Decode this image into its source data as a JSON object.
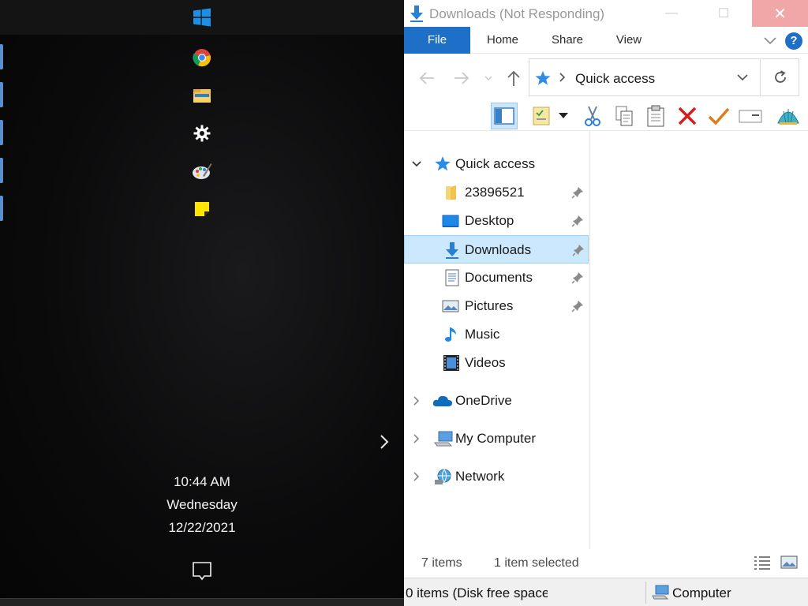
{
  "clock": {
    "time": "10:44 AM",
    "day": "Wednesday",
    "date": "12/22/2021"
  },
  "start_tiles": [
    {
      "name": "windows-logo-icon"
    },
    {
      "name": "chrome-icon"
    },
    {
      "name": "file-explorer-icon"
    },
    {
      "name": "settings-gear-icon"
    },
    {
      "name": "paint-icon"
    },
    {
      "name": "sticky-notes-icon"
    }
  ],
  "window": {
    "title": "Downloads (Not Responding)",
    "controls": {
      "minimize": "—",
      "maximize": "☐",
      "close": "✕"
    }
  },
  "ribbon": {
    "tabs": [
      "File",
      "Home",
      "Share",
      "View"
    ],
    "help": "?"
  },
  "address": {
    "current": "Quick access"
  },
  "nav_pane": {
    "quick_access": "Quick access",
    "items": [
      {
        "label": "23896521",
        "icon": "folder-icon",
        "pinned": true
      },
      {
        "label": "Desktop",
        "icon": "desktop-icon",
        "pinned": true
      },
      {
        "label": "Downloads",
        "icon": "download-arrow-icon",
        "pinned": true,
        "selected": true
      },
      {
        "label": "Documents",
        "icon": "documents-icon",
        "pinned": true
      },
      {
        "label": "Pictures",
        "icon": "pictures-icon",
        "pinned": true
      },
      {
        "label": "Music",
        "icon": "music-note-icon",
        "pinned": false
      },
      {
        "label": "Videos",
        "icon": "videos-icon",
        "pinned": false
      }
    ],
    "roots": [
      {
        "label": "OneDrive",
        "icon": "onedrive-cloud-icon"
      },
      {
        "label": "My Computer",
        "icon": "computer-icon"
      },
      {
        "label": "Network",
        "icon": "network-globe-icon"
      }
    ]
  },
  "status": {
    "count": "7 items",
    "selected": "1 item selected"
  },
  "bottom_bar": {
    "left": "0 items (Disk free space",
    "right": "Computer"
  },
  "colors": {
    "accent": "#1e6fc7",
    "selection": "#cce8ff",
    "close_hover": "#f1a7a8"
  }
}
